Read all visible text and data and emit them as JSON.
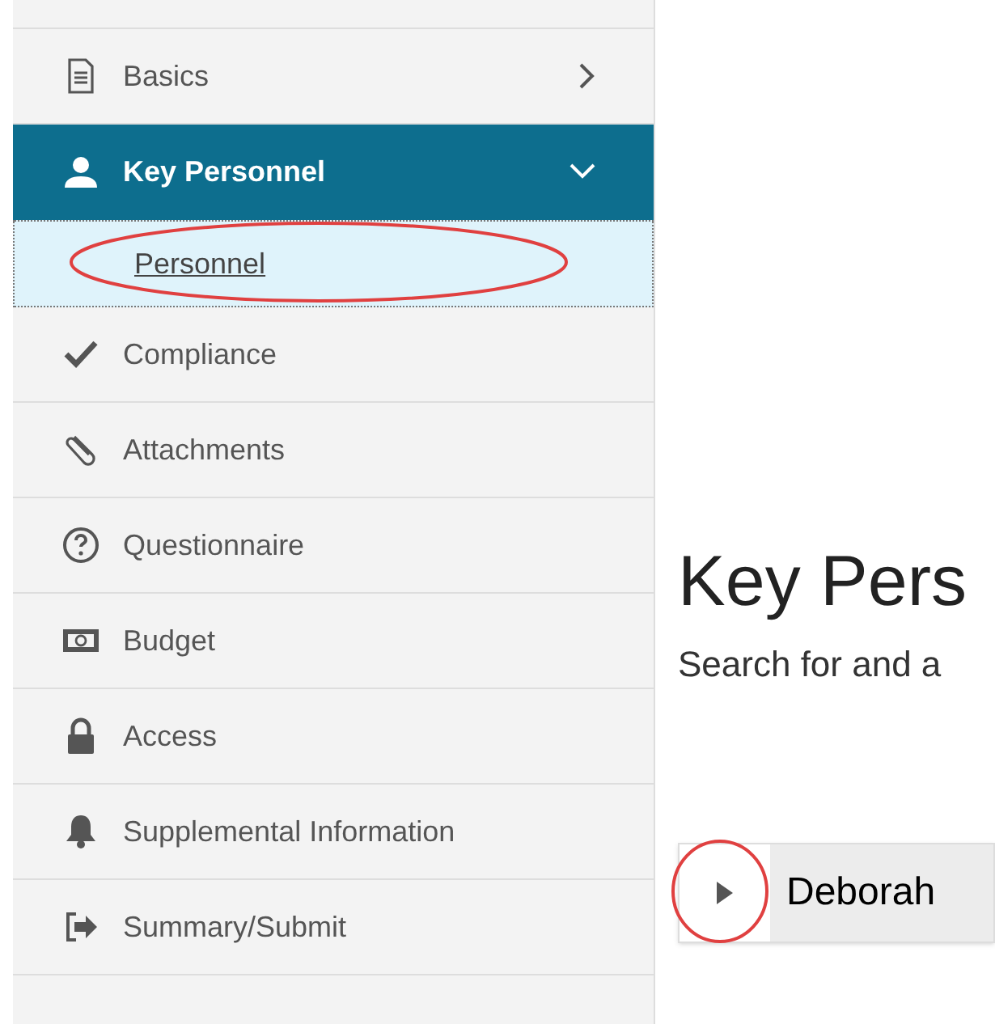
{
  "sidebar": {
    "items": [
      {
        "kind": "section",
        "label": "Basics",
        "expanded": false,
        "selected": false
      },
      {
        "kind": "section",
        "label": "Key Personnel",
        "expanded": true,
        "selected": true
      },
      {
        "kind": "sub",
        "label": "Personnel",
        "selected": true
      },
      {
        "kind": "section",
        "label": "Compliance",
        "selected": false
      },
      {
        "kind": "section",
        "label": "Attachments",
        "selected": false
      },
      {
        "kind": "section",
        "label": "Questionnaire",
        "selected": false
      },
      {
        "kind": "section",
        "label": "Budget",
        "selected": false
      },
      {
        "kind": "section",
        "label": "Access",
        "selected": false
      },
      {
        "kind": "section",
        "label": "Supplemental Information",
        "selected": false
      },
      {
        "kind": "section",
        "label": "Summary/Submit",
        "selected": false
      }
    ]
  },
  "main": {
    "heading": "Key Pers",
    "description": "Search for and a",
    "rows": [
      {
        "name": "Deborah",
        "expanded": false
      }
    ]
  }
}
